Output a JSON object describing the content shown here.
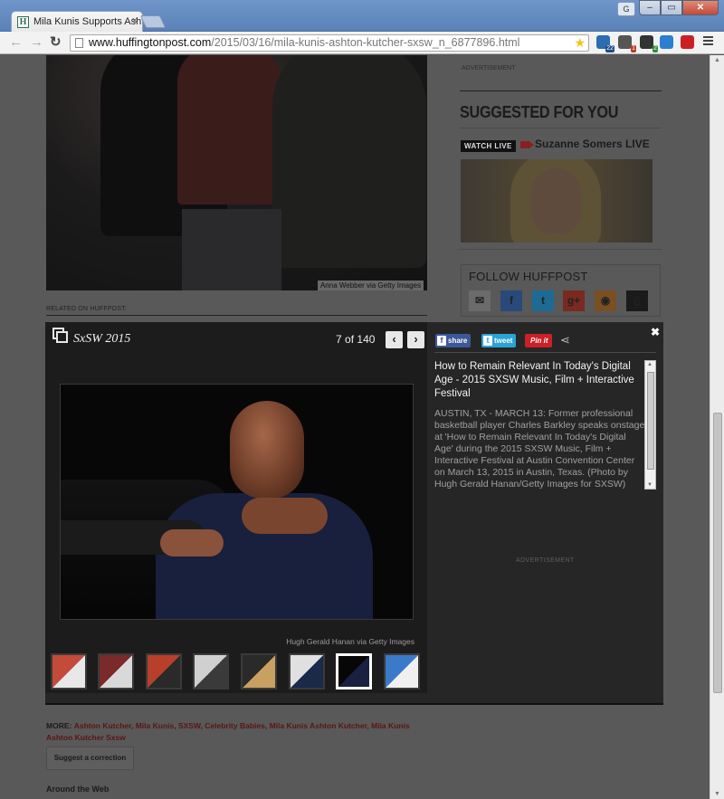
{
  "browser": {
    "tab_title": "Mila Kunis Supports Ashton",
    "favicon_letter": "H",
    "url_host": "www.huffingtonpost.com",
    "url_path": "/2015/03/16/mila-kunis-ashton-kutcher-sxsw_n_6877896.html",
    "extensions": [
      {
        "name": "lastpass",
        "badge": "22",
        "color": "#2b6cb3"
      },
      {
        "name": "ghostery",
        "badge": "1",
        "color": "#555555"
      },
      {
        "name": "analytics",
        "badge": "2",
        "color": "#333333"
      },
      {
        "name": "ext-blue",
        "badge": "",
        "color": "#2a7fd1"
      },
      {
        "name": "pinterest",
        "badge": "",
        "color": "#cb2027"
      }
    ]
  },
  "article": {
    "photo_credit": "Anna Webber via Getty Images",
    "related_label": "RELATED ON HUFFPOST:"
  },
  "sidebar": {
    "ad_label": "ADVERTISEMENT",
    "suggested_title": "SUGGESTED FOR YOU",
    "watch_live": "WATCH LIVE",
    "live_title": "Suzanne Somers LIVE",
    "follow_title": "FOLLOW HUFFPOST",
    "social": [
      {
        "name": "email",
        "glyph": "✉",
        "color": "#6b6b6b"
      },
      {
        "name": "facebook",
        "glyph": "f",
        "color": "#29497a"
      },
      {
        "name": "twitter",
        "glyph": "t",
        "color": "#1d6b94"
      },
      {
        "name": "google-plus",
        "glyph": "g+",
        "color": "#7a2a20"
      },
      {
        "name": "rss",
        "glyph": "◉",
        "color": "#7a4f22"
      },
      {
        "name": "mobile",
        "glyph": "▯",
        "color": "#1a1a1a"
      }
    ]
  },
  "slideshow": {
    "title": "SxSW 2015",
    "current": "7",
    "of_label": "of",
    "total": "140",
    "prev_glyph": "‹",
    "next_glyph": "›",
    "close_glyph": "✖",
    "photo_credit": "Hugh Gerald Hanan via Getty Images",
    "share_label": "share",
    "tweet_label": "tweet",
    "pin_label": "Pin it",
    "caption_title": "How to Remain Relevant In Today's Digital Age - 2015 SXSW Music, Film + Interactive Festival",
    "caption_text": "AUSTIN, TX - MARCH 13: Former professional basketball player Charles Barkley speaks onstage at 'How to Remain Relevant In Today's Digital Age' during the 2015 SXSW Music, Film + Interactive Festival at Austin Convention Center on March 13, 2015 in Austin, Texas. (Photo by Hugh Gerald Hanan/Getty Images for SXSW)",
    "ad_label": "ADVERTISEMENT",
    "thumbnails": [
      {
        "active": false,
        "colors": [
          "#c44a3a",
          "#e8e8e8"
        ]
      },
      {
        "active": false,
        "colors": [
          "#7a2a2a",
          "#d9d9d9"
        ]
      },
      {
        "active": false,
        "colors": [
          "#b8402a",
          "#2a2a2a"
        ]
      },
      {
        "active": false,
        "colors": [
          "#d0d0d0",
          "#3a3a3a"
        ]
      },
      {
        "active": false,
        "colors": [
          "#2a2a2a",
          "#c8a060"
        ]
      },
      {
        "active": false,
        "colors": [
          "#e0e0e0",
          "#1a2a4a"
        ]
      },
      {
        "active": true,
        "colors": [
          "#070707",
          "#1a2040"
        ]
      },
      {
        "active": false,
        "colors": [
          "#3a7ac8",
          "#f0f0f0"
        ]
      }
    ]
  },
  "footer": {
    "more_label": "MORE:",
    "tags": "Ashton Kutcher, Mila Kunis, SXSW, Celebrity Babies, Mila Kunis Ashton Kutcher, Mila Kunis Ashton Kutcher Sxsw",
    "correction_label": "Suggest a correction",
    "around_label": "Around the Web"
  }
}
